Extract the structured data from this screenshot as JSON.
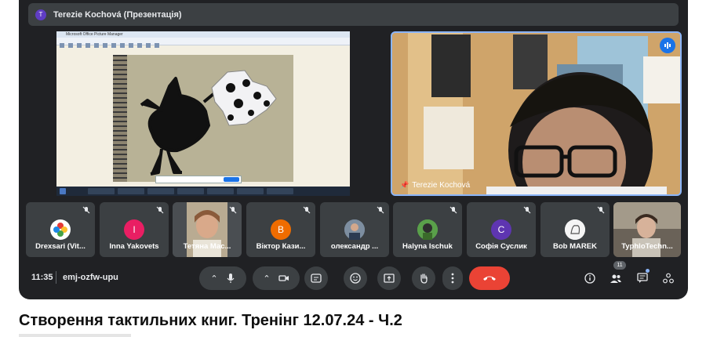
{
  "banner": {
    "avatar_letter": "T",
    "title": "Terezie Kochová (Презентація)"
  },
  "shared_screen": {
    "window_title": "Microsoft Office Picture Manager"
  },
  "camera": {
    "name": "Terezie Kochová"
  },
  "participants": [
    {
      "name": "Drexsari (Vit...",
      "avatar_letter": "",
      "avatar_color": "#ffffff"
    },
    {
      "name": "Inna Yakovets",
      "avatar_letter": "I",
      "avatar_color": "#e91e63"
    },
    {
      "name": "Тетяна Мас...",
      "avatar_letter": "",
      "avatar_color": "#9e8f7a"
    },
    {
      "name": "Віктор Кази...",
      "avatar_letter": "В",
      "avatar_color": "#ef6c00"
    },
    {
      "name": "олександр ...",
      "avatar_letter": "",
      "avatar_color": "#6a7b8c"
    },
    {
      "name": "Halyna Ischuk",
      "avatar_letter": "",
      "avatar_color": "#4caf50"
    },
    {
      "name": "Софія Суслик",
      "avatar_letter": "С",
      "avatar_color": "#5e35b1"
    },
    {
      "name": "Bob MAREK",
      "avatar_letter": "",
      "avatar_color": "#e0e0e0"
    },
    {
      "name": "TyphloTechn...",
      "avatar_letter": "",
      "avatar_color": "#8a7f70"
    }
  ],
  "controls": {
    "time": "11:35",
    "meeting_code": "emj-ozfw-upu",
    "people_count": "11"
  },
  "page": {
    "title": "Створення тактильних книг. Тренінг 12.07.24 - Ч.2"
  },
  "colors": {
    "end_call": "#ea4335",
    "accent": "#8ab4f8",
    "tile": "#3c4043",
    "frame": "#202124"
  }
}
